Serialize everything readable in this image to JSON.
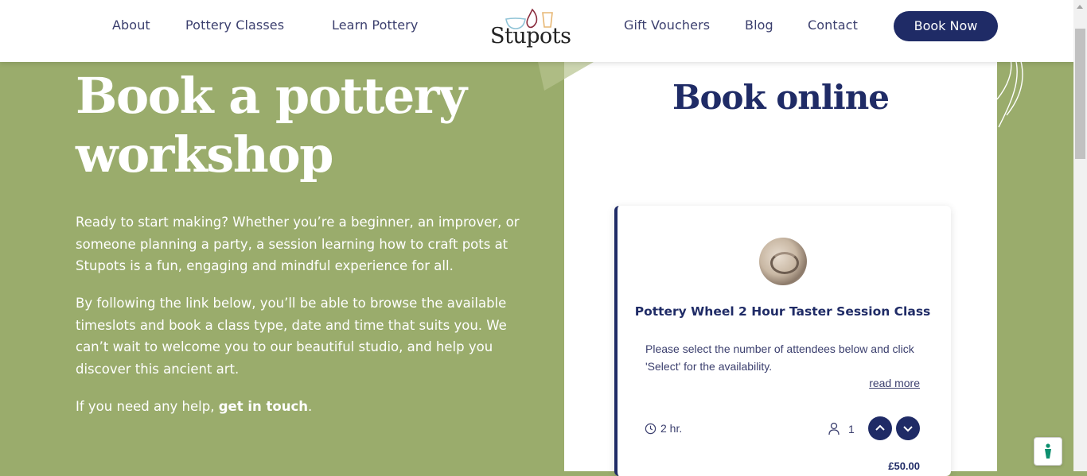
{
  "nav": {
    "links": [
      "About",
      "Pottery Classes",
      "Learn Pottery",
      "Gift Vouchers",
      "Blog",
      "Contact"
    ],
    "logo_text": "Stupots",
    "cta_label": "Book Now"
  },
  "hero": {
    "title_line1": "Book a pottery",
    "title_line2": "workshop",
    "para1": "Ready to start making? Whether you’re a beginner, an improver, or someone planning a party, a session learning how to craft pots at Stupots is a fun, engaging and mindful experience for all.",
    "para2": "By following the link below, you’ll be able to browse the available timeslots and book a class type, date and time that suits you. We can’t wait to welcome you to our beautiful studio, and help you discover this ancient art.",
    "help_prefix": "If you need any help,",
    "help_link": "get in touch",
    "help_suffix": "."
  },
  "booking": {
    "heading": "Book online",
    "card": {
      "title": "Pottery Wheel 2 Hour Taster Session Class",
      "description": "Please select the number of attendees below and click 'Select' for the availability.",
      "read_more": "read more",
      "duration": "2 hr.",
      "attendees": "1",
      "price": "£50.00"
    }
  },
  "icons": {
    "clock": "clock-icon",
    "person": "person-icon",
    "up": "chevron-up-icon",
    "down": "chevron-down-icon",
    "help": "accessibility-icon"
  },
  "colors": {
    "brand_navy": "#1f2b66",
    "hero_green": "#9aac6c",
    "text_navy": "#3b3f6e"
  }
}
